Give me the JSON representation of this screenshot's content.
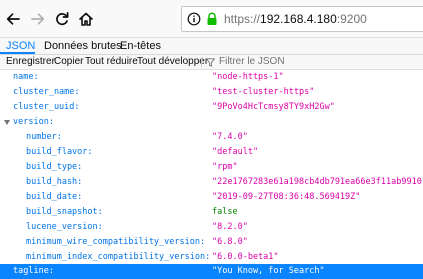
{
  "url": {
    "scheme": "https://",
    "host": "192.168.4.180",
    "port": ":9200"
  },
  "tabs": [
    {
      "label": "JSON",
      "active": true
    },
    {
      "label": "Données brutes",
      "active": false
    },
    {
      "label": "En-têtes",
      "active": false
    }
  ],
  "subtoolbar": {
    "save": "Enregistrer",
    "copy": "Copier",
    "collapse_all": "Tout réduire",
    "expand_all": "Tout développer",
    "filter_placeholder": "Filtrer le JSON"
  },
  "json": {
    "rows": [
      {
        "key": "name:",
        "value": "\"node-https-1\"",
        "type": "string"
      },
      {
        "key": "cluster_name:",
        "value": "\"test-cluster-https\"",
        "type": "string"
      },
      {
        "key": "cluster_uuid:",
        "value": "\"9PoVo4HcTcmsy8TY9xH2Gw\"",
        "type": "string"
      },
      {
        "key": "version:",
        "value": "",
        "type": "object"
      },
      {
        "key": "number:",
        "value": "\"7.4.0\"",
        "type": "string"
      },
      {
        "key": "build_flavor:",
        "value": "\"default\"",
        "type": "string"
      },
      {
        "key": "build_type:",
        "value": "\"rpm\"",
        "type": "string"
      },
      {
        "key": "build_hash:",
        "value": "\"22e1767283e61a198cb4db791ea66e3f11ab9910\"",
        "type": "string"
      },
      {
        "key": "build_date:",
        "value": "\"2019-09-27T08:36:48.569419Z\"",
        "type": "string"
      },
      {
        "key": "build_snapshot:",
        "value": "false",
        "type": "bool"
      },
      {
        "key": "lucene_version:",
        "value": "\"8.2.0\"",
        "type": "string"
      },
      {
        "key": "minimum_wire_compatibility_version:",
        "value": "\"6.8.0\"",
        "type": "string"
      },
      {
        "key": "minimum_index_compatibility_version:",
        "value": "\"6.0.0-beta1\"",
        "type": "string"
      },
      {
        "key": "tagline:",
        "value": "\"You Know, for Search\"",
        "type": "string"
      }
    ]
  },
  "colors": {
    "key": "#0074e8",
    "string": "#dd00a9",
    "bool": "#058b00",
    "selection": "#0a84ff"
  }
}
